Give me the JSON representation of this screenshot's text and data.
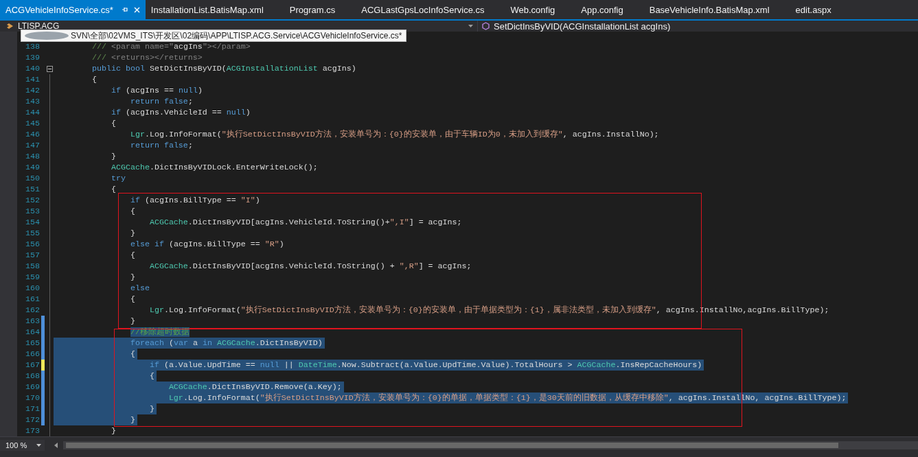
{
  "tabs": [
    {
      "label": "ACGVehicleInfoService.cs*",
      "selected": true
    },
    {
      "label": "InstallationList.BatisMap.xml",
      "selected": false
    },
    {
      "label": "Program.cs",
      "selected": false
    },
    {
      "label": "ACGLastGpsLocInfoService.cs",
      "selected": false
    },
    {
      "label": "Web.config",
      "selected": false
    },
    {
      "label": "App.config",
      "selected": false
    },
    {
      "label": "BaseVehicleInfo.BatisMap.xml",
      "selected": false
    },
    {
      "label": "edit.aspx",
      "selected": false
    }
  ],
  "navigation": {
    "type_dropdown": "LTISP.ACG",
    "member_dropdown": "SetDictInsByVID(ACGInstallationList acgIns)"
  },
  "tooltip": {
    "text": "SVN\\全部\\02VMS_ITS\\开发区\\02编码\\APP\\LTISP.ACG.Service\\ACGVehicleInfoService.cs*"
  },
  "code": {
    "blocks": [
      {
        "kind": "plain",
        "lines": [
          {
            "number": "138",
            "modified": false,
            "selected": false,
            "tokens": [
              {
                "kind": "doc",
                "text": "        ///"
              },
              {
                "kind": "tag",
                "text": " <param name=\""
              },
              {
                "kind": "plain",
                "text": "acgIns"
              },
              {
                "kind": "tag",
                "text": "\"></param>"
              }
            ]
          },
          {
            "number": "139",
            "modified": false,
            "selected": false,
            "tokens": [
              {
                "kind": "doc",
                "text": "        ///"
              },
              {
                "kind": "tag",
                "text": " <returns></returns>"
              }
            ]
          },
          {
            "number": "140",
            "modified": false,
            "selected": false,
            "expanded": true,
            "tokens": [
              {
                "kind": "keyword",
                "text": "        public"
              },
              {
                "kind": "keyword",
                "text": " bool"
              },
              {
                "kind": "plain",
                "text": " SetDictInsByVID("
              },
              {
                "kind": "type",
                "text": "ACGInstallationList"
              },
              {
                "kind": "plain",
                "text": " acgIns)"
              }
            ]
          },
          {
            "number": "141",
            "modified": false,
            "selected": false,
            "tokens": [
              {
                "kind": "plain",
                "text": "        {"
              }
            ]
          },
          {
            "number": "142",
            "modified": false,
            "selected": false,
            "tokens": [
              {
                "kind": "keyword",
                "text": "            if"
              },
              {
                "kind": "plain",
                "text": " (acgIns == "
              },
              {
                "kind": "keyword",
                "text": "null"
              },
              {
                "kind": "plain",
                "text": ")"
              }
            ]
          },
          {
            "number": "143",
            "modified": false,
            "selected": false,
            "tokens": [
              {
                "kind": "keyword",
                "text": "                return"
              },
              {
                "kind": "keyword",
                "text": " false"
              },
              {
                "kind": "plain",
                "text": ";"
              }
            ]
          },
          {
            "number": "144",
            "modified": false,
            "selected": false,
            "tokens": [
              {
                "kind": "keyword",
                "text": "            if"
              },
              {
                "kind": "plain",
                "text": " (acgIns.VehicleId == "
              },
              {
                "kind": "keyword",
                "text": "null"
              },
              {
                "kind": "plain",
                "text": ")"
              }
            ]
          },
          {
            "number": "145",
            "modified": false,
            "selected": false,
            "tokens": [
              {
                "kind": "plain",
                "text": "            {"
              }
            ]
          },
          {
            "number": "146",
            "modified": false,
            "selected": false,
            "tokens": [
              {
                "kind": "type",
                "text": "                Lgr"
              },
              {
                "kind": "plain",
                "text": ".Log.InfoFormat("
              },
              {
                "kind": "string",
                "text": "\"执行SetDictInsByVID方法，安装单号为：{0}的安装单，由于车辆ID为0，未加入到缓存\""
              },
              {
                "kind": "plain",
                "text": ", acgIns.InstallNo);"
              }
            ]
          },
          {
            "number": "147",
            "modified": false,
            "selected": false,
            "tokens": [
              {
                "kind": "keyword",
                "text": "                return"
              },
              {
                "kind": "keyword",
                "text": " false"
              },
              {
                "kind": "plain",
                "text": ";"
              }
            ]
          },
          {
            "number": "148",
            "modified": false,
            "selected": false,
            "tokens": [
              {
                "kind": "plain",
                "text": "            }"
              }
            ]
          },
          {
            "number": "149",
            "modified": false,
            "selected": false,
            "tokens": [
              {
                "kind": "type",
                "text": "            ACGCache"
              },
              {
                "kind": "plain",
                "text": ".DictInsByVIDLock.EnterWriteLock();"
              }
            ]
          },
          {
            "number": "150",
            "modified": false,
            "selected": false,
            "tokens": [
              {
                "kind": "keyword",
                "text": "            try"
              }
            ]
          },
          {
            "number": "151",
            "modified": false,
            "selected": false,
            "tokens": [
              {
                "kind": "plain",
                "text": "            {"
              }
            ]
          }
        ]
      },
      {
        "kind": "boxed",
        "lines": [
          {
            "number": "152",
            "modified": false,
            "selected": false,
            "tokens": [
              {
                "kind": "keyword",
                "text": "                if"
              },
              {
                "kind": "plain",
                "text": " (acgIns.BillType == "
              },
              {
                "kind": "string",
                "text": "\"I\""
              },
              {
                "kind": "plain",
                "text": ")"
              }
            ]
          },
          {
            "number": "153",
            "modified": false,
            "selected": false,
            "tokens": [
              {
                "kind": "plain",
                "text": "                {"
              }
            ]
          },
          {
            "number": "154",
            "modified": false,
            "selected": false,
            "tokens": [
              {
                "kind": "type",
                "text": "                    ACGCache"
              },
              {
                "kind": "plain",
                "text": ".DictInsByVID[acgIns.VehicleId.ToString()+"
              },
              {
                "kind": "string",
                "text": "\",I\""
              },
              {
                "kind": "plain",
                "text": "] = acgIns;"
              }
            ]
          },
          {
            "number": "155",
            "modified": false,
            "selected": false,
            "tokens": [
              {
                "kind": "plain",
                "text": "                }"
              }
            ]
          },
          {
            "number": "156",
            "modified": false,
            "selected": false,
            "tokens": [
              {
                "kind": "keyword",
                "text": "                else"
              },
              {
                "kind": "keyword",
                "text": " if"
              },
              {
                "kind": "plain",
                "text": " (acgIns.BillType == "
              },
              {
                "kind": "string",
                "text": "\"R\""
              },
              {
                "kind": "plain",
                "text": ")"
              }
            ]
          },
          {
            "number": "157",
            "modified": false,
            "selected": false,
            "tokens": [
              {
                "kind": "plain",
                "text": "                {"
              }
            ]
          },
          {
            "number": "158",
            "modified": false,
            "selected": false,
            "tokens": [
              {
                "kind": "type",
                "text": "                    ACGCache"
              },
              {
                "kind": "plain",
                "text": ".DictInsByVID[acgIns.VehicleId.ToString() + "
              },
              {
                "kind": "string",
                "text": "\",R\""
              },
              {
                "kind": "plain",
                "text": "] = acgIns;"
              }
            ]
          },
          {
            "number": "159",
            "modified": false,
            "selected": false,
            "tokens": [
              {
                "kind": "plain",
                "text": "                }"
              }
            ]
          },
          {
            "number": "160",
            "modified": false,
            "selected": false,
            "tokens": [
              {
                "kind": "keyword",
                "text": "                else"
              }
            ]
          },
          {
            "number": "161",
            "modified": false,
            "selected": false,
            "tokens": [
              {
                "kind": "plain",
                "text": "                {"
              }
            ]
          },
          {
            "number": "162",
            "modified": false,
            "selected": false,
            "tokens": [
              {
                "kind": "type",
                "text": "                    Lgr"
              },
              {
                "kind": "plain",
                "text": ".Log.InfoFormat("
              },
              {
                "kind": "string",
                "text": "\"执行SetDictInsByVID方法，安装单号为：{0}的安装单，由于单据类型为：{1}，属非法类型，未加入到缓存\""
              },
              {
                "kind": "plain",
                "text": ", acgIns.InstallNo,acgIns.BillType);"
              }
            ]
          },
          {
            "number": "163",
            "modified": true,
            "saved": true,
            "selected": false,
            "tokens": [
              {
                "kind": "plain",
                "text": "                }"
              }
            ]
          }
        ]
      },
      {
        "kind": "boxed",
        "lines": [
          {
            "number": "164",
            "modified": true,
            "saved": true,
            "selected": true,
            "text_only": true,
            "tokens": [
              {
                "kind": "comment",
                "text": "                //移除超时数据"
              }
            ]
          },
          {
            "number": "165",
            "modified": true,
            "saved": true,
            "selected": true,
            "tokens": [
              {
                "kind": "keyword",
                "text": "                foreach"
              },
              {
                "kind": "plain",
                "text": " ("
              },
              {
                "kind": "keyword",
                "text": "var"
              },
              {
                "kind": "plain",
                "text": " a "
              },
              {
                "kind": "keyword",
                "text": "in"
              },
              {
                "kind": "type",
                "text": " ACGCache"
              },
              {
                "kind": "plain",
                "text": ".DictInsByVID)"
              }
            ]
          },
          {
            "number": "166",
            "modified": true,
            "saved": true,
            "selected": true,
            "tokens": [
              {
                "kind": "plain",
                "text": "                {"
              }
            ]
          },
          {
            "number": "167",
            "modified": true,
            "saved": false,
            "selected": true,
            "tokens": [
              {
                "kind": "keyword",
                "text": "                    if"
              },
              {
                "kind": "plain",
                "text": " (a.Value.UpdTime == "
              },
              {
                "kind": "keyword",
                "text": "null"
              },
              {
                "kind": "plain",
                "text": " || "
              },
              {
                "kind": "type",
                "text": "DateTime"
              },
              {
                "kind": "plain",
                "text": ".Now.Subtract(a.Value.UpdTime.Value).TotalHours > "
              },
              {
                "kind": "type",
                "text": "ACGCache"
              },
              {
                "kind": "plain",
                "text": ".InsRepCacheHours)"
              }
            ]
          },
          {
            "number": "168",
            "modified": true,
            "saved": true,
            "selected": true,
            "tokens": [
              {
                "kind": "plain",
                "text": "                    {"
              }
            ]
          },
          {
            "number": "169",
            "modified": true,
            "saved": true,
            "selected": true,
            "tokens": [
              {
                "kind": "type",
                "text": "                        ACGCache"
              },
              {
                "kind": "plain",
                "text": ".DictInsByVID.Remove(a.Key);"
              }
            ]
          },
          {
            "number": "170",
            "modified": true,
            "saved": true,
            "selected": true,
            "tokens": [
              {
                "kind": "type",
                "text": "                        Lgr"
              },
              {
                "kind": "plain",
                "text": ".Log.InfoFormat("
              },
              {
                "kind": "string",
                "text": "\"执行SetDictInsByVID方法，安装单号为：{0}的单据，单据类型：{1}，是30天前的旧数据，从缓存中移除\""
              },
              {
                "kind": "plain",
                "text": ", acgIns.InstallNo, acgIns.BillType);"
              }
            ]
          },
          {
            "number": "171",
            "modified": true,
            "saved": true,
            "selected": true,
            "tokens": [
              {
                "kind": "plain",
                "text": "                    }"
              }
            ]
          },
          {
            "number": "172",
            "modified": true,
            "saved": true,
            "selected": true,
            "tokens": [
              {
                "kind": "plain",
                "text": "                }"
              }
            ]
          }
        ]
      },
      {
        "kind": "plain",
        "lines": [
          {
            "number": "173",
            "modified": false,
            "selected": false,
            "tokens": [
              {
                "kind": "plain",
                "text": "            }"
              }
            ]
          }
        ]
      }
    ]
  },
  "status": {
    "zoom": "100 %"
  }
}
